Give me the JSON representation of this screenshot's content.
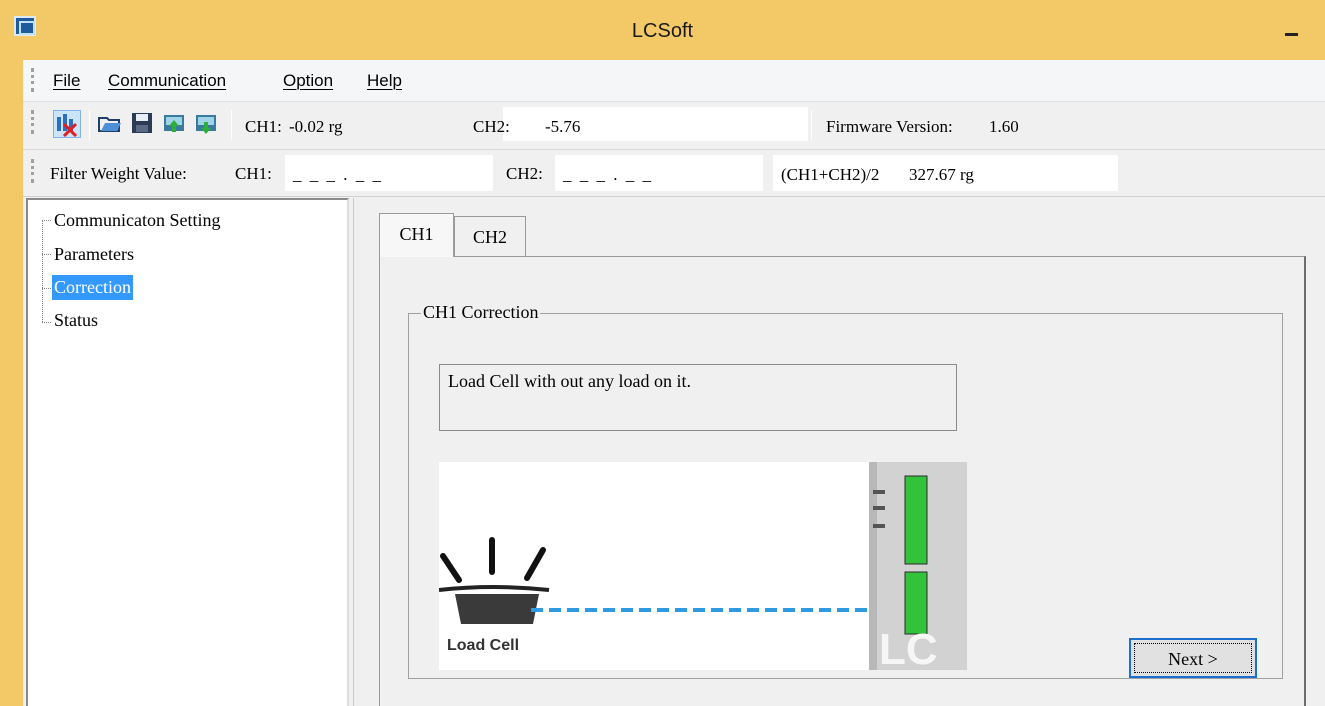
{
  "window": {
    "title": "LCSoft"
  },
  "menu": {
    "items": [
      {
        "label": "File"
      },
      {
        "label": "Communication"
      },
      {
        "label": "Option"
      },
      {
        "label": "Help"
      }
    ]
  },
  "toolbar": {
    "icons": [
      "disconnect-icon",
      "open-folder-icon",
      "save-icon",
      "upload-icon",
      "download-icon"
    ],
    "ch1_label": "CH1:",
    "ch1_value": "-0.02 rg",
    "ch2_label": "CH2:",
    "ch2_value": "-5.76",
    "firmware_label": "Firmware Version:",
    "firmware_value": "1.60"
  },
  "filter": {
    "label": "Filter Weight Value:",
    "ch1_label": "CH1:",
    "ch1_value": "_ _ _ . _ _",
    "ch2_label": "CH2:",
    "ch2_value": "_ _ _ . _ _",
    "avg_label": "(CH1+CH2)/2",
    "avg_value": "327.67 rg"
  },
  "tree": {
    "items": [
      {
        "label": "Communicaton Setting"
      },
      {
        "label": "Parameters"
      },
      {
        "label": "Correction",
        "selected": true
      },
      {
        "label": "Status"
      }
    ]
  },
  "tabs": [
    {
      "label": "CH1",
      "active": true
    },
    {
      "label": "CH2"
    }
  ],
  "correction": {
    "group_title": "CH1 Correction",
    "message": "Load Cell with out any load on it.",
    "illustration_label": "Load Cell",
    "device_logo": "LC",
    "next_label": "Next >"
  },
  "colors": {
    "titlebar": "#f3c867",
    "selection": "#3399ff",
    "cable": "#2e9be0",
    "terminal": "#33c33b"
  }
}
